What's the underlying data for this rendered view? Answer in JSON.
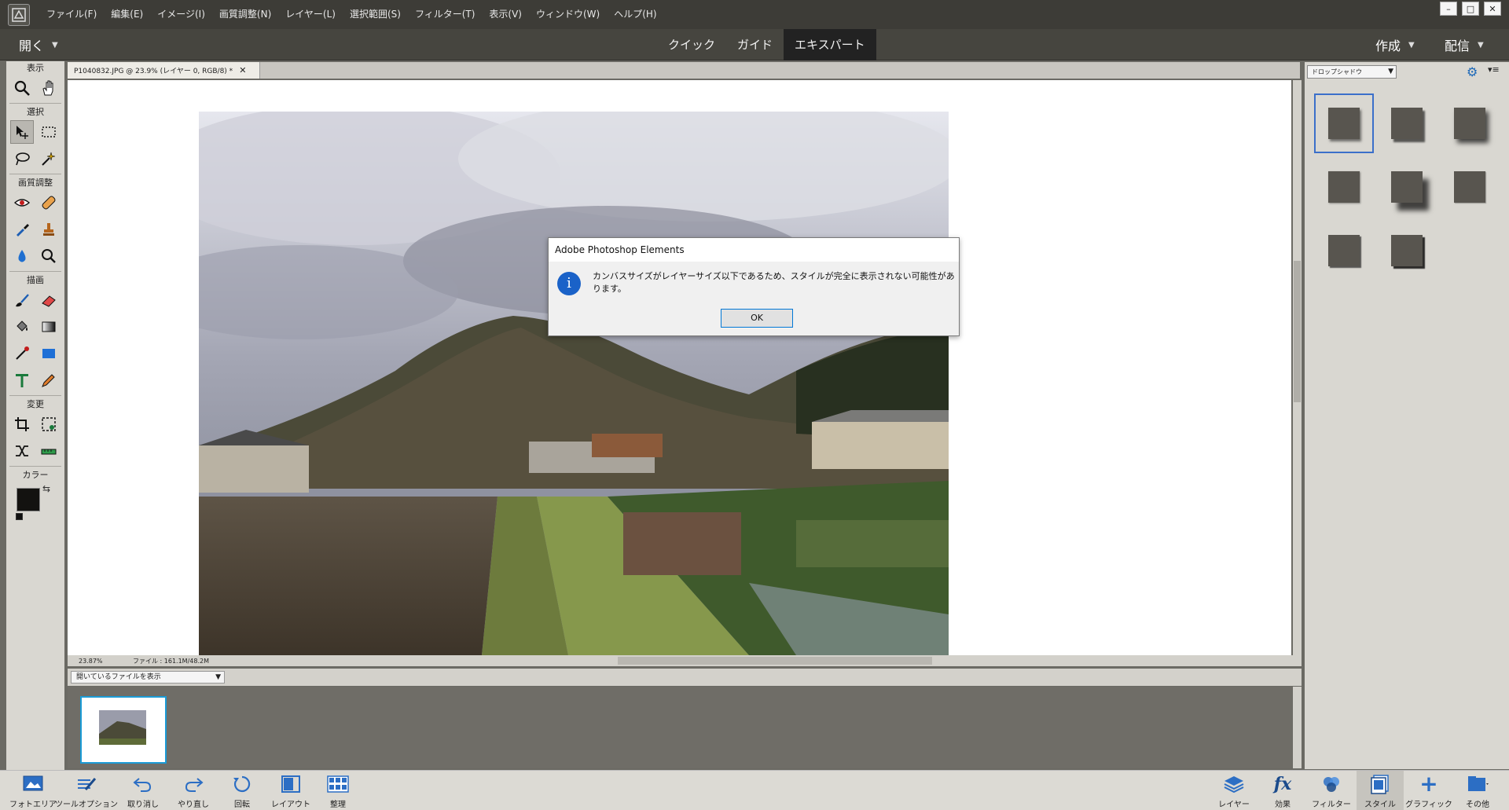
{
  "menubar": {
    "items": [
      "ファイル(F)",
      "編集(E)",
      "イメージ(I)",
      "画質調整(N)",
      "レイヤー(L)",
      "選択範囲(S)",
      "フィルター(T)",
      "表示(V)",
      "ウィンドウ(W)",
      "ヘルプ(H)"
    ],
    "window_controls": [
      "–",
      "□",
      "✕"
    ]
  },
  "modebar": {
    "open_label": "開く",
    "tabs": [
      "クイック",
      "ガイド",
      "エキスパート"
    ],
    "active_tab": "エキスパート",
    "create_label": "作成",
    "share_label": "配信"
  },
  "toolbox": {
    "groups": {
      "view": "表示",
      "select": "選択",
      "enhance": "画質調整",
      "draw": "描画",
      "modify": "変更",
      "color": "カラー"
    },
    "foreground_color": "#131210",
    "background_color": "#ffffff"
  },
  "document": {
    "tab_title": "P1040832.JPG @ 23.9% (レイヤー 0, RGB/8) *",
    "close_glyph": "✕"
  },
  "status": {
    "zoom": "23.87%",
    "file_size": "ファイル : 161.1M/48.2M"
  },
  "photo_bin": {
    "filter_label": "開いているファイルを表示"
  },
  "right_panel": {
    "dropdown_label": "ドロップシャドウ",
    "style_count": 8,
    "selected_index": 0
  },
  "taskbar": {
    "left": [
      {
        "label": "フォトエリア"
      },
      {
        "label": "ツールオプション"
      },
      {
        "label": "取り消し"
      },
      {
        "label": "やり直し"
      },
      {
        "label": "回転"
      },
      {
        "label": "レイアウト"
      },
      {
        "label": "整理"
      }
    ],
    "right": [
      {
        "label": "レイヤー"
      },
      {
        "label": "効果"
      },
      {
        "label": "フィルター"
      },
      {
        "label": "スタイル"
      },
      {
        "label": "グラフィック"
      },
      {
        "label": "その他"
      }
    ],
    "fx_glyph": "fx",
    "plus_glyph": "+"
  },
  "dialog": {
    "title": "Adobe Photoshop Elements",
    "message": "カンバスサイズがレイヤーサイズ以下であるため、スタイルが完全に表示されない可能性があります。",
    "ok_label": "OK",
    "info_glyph": "i"
  },
  "colors": {
    "accent": "#1a62c8",
    "selection_border": "#3b6fca"
  }
}
